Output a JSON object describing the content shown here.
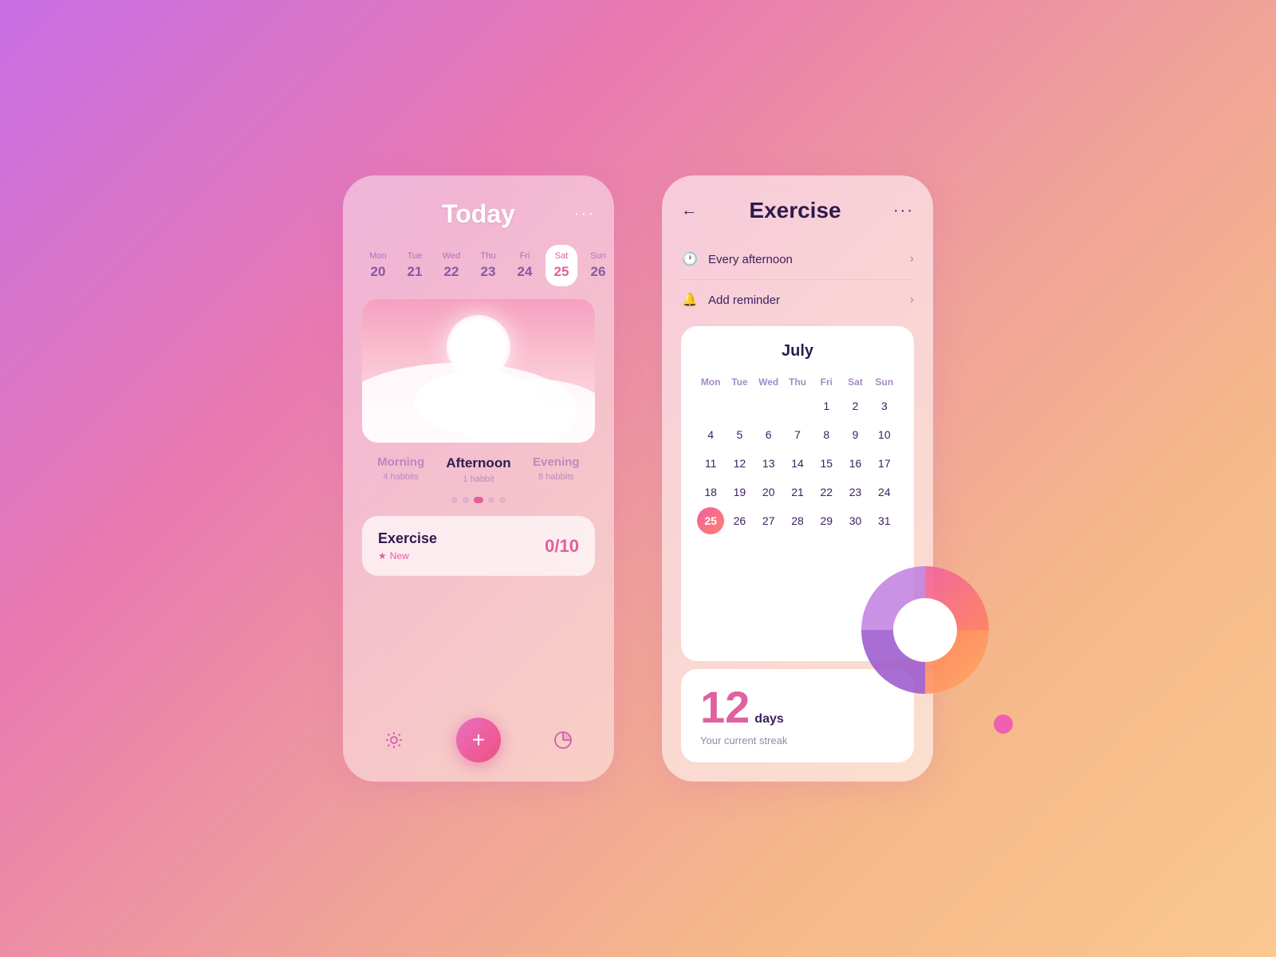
{
  "left_card": {
    "title": "Today",
    "menu_dots": "···",
    "date_strip": [
      {
        "day": "Mon",
        "num": "20",
        "active": false
      },
      {
        "day": "Tue",
        "num": "21",
        "active": false
      },
      {
        "day": "Wed",
        "num": "22",
        "active": false
      },
      {
        "day": "Thu",
        "num": "23",
        "active": false
      },
      {
        "day": "Fri",
        "num": "24",
        "active": false
      },
      {
        "day": "Sat",
        "num": "25",
        "active": true
      },
      {
        "day": "Sun",
        "num": "26",
        "active": false
      }
    ],
    "periods": [
      {
        "label": "Morning",
        "count": "4 habbits",
        "active": false
      },
      {
        "label": "Afternoon",
        "count": "1 habbit",
        "active": true
      },
      {
        "label": "Evening",
        "count": "8 habbits",
        "active": false
      }
    ],
    "exercise": {
      "name": "Exercise",
      "badge": "New",
      "progress": "0/10"
    },
    "nav": {
      "sun_icon": "☀",
      "add_icon": "+",
      "chart_icon": "◕"
    }
  },
  "right_card": {
    "title": "Exercise",
    "back_label": "←",
    "menu_dots": "···",
    "info_rows": [
      {
        "icon": "🕐",
        "text": "Every afternoon"
      },
      {
        "icon": "🔔",
        "text": "Add reminder"
      }
    ],
    "calendar": {
      "month": "July",
      "headers": [
        "Mon",
        "Tue",
        "Wed",
        "Thu",
        "Fri",
        "Sat",
        "Sun"
      ],
      "weeks": [
        [
          "",
          "",
          "",
          "",
          "1",
          "2",
          "3"
        ],
        [
          "4",
          "5",
          "6",
          "7",
          "8",
          "9",
          "10"
        ],
        [
          "11",
          "12",
          "13",
          "14",
          "15",
          "16",
          "17"
        ],
        [
          "18",
          "19",
          "20",
          "21",
          "22",
          "23",
          "24"
        ],
        [
          "25",
          "26",
          "27",
          "28",
          "29",
          "30",
          "31"
        ]
      ],
      "active_day": "25"
    },
    "streak": {
      "number": "12",
      "unit": "days",
      "label": "Your current streak"
    }
  }
}
